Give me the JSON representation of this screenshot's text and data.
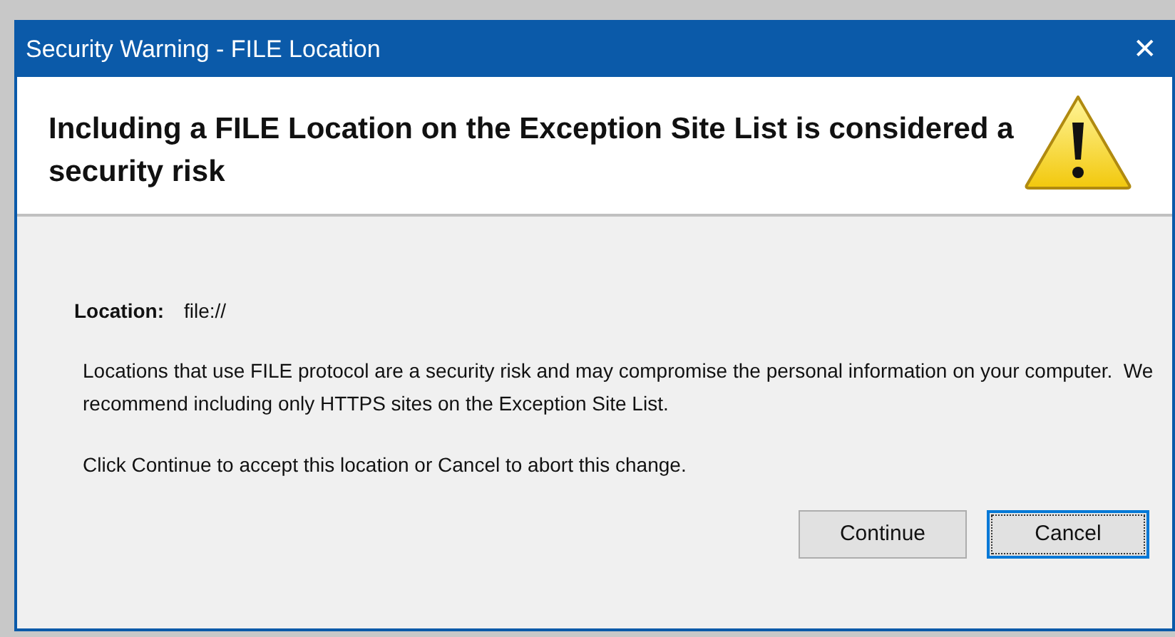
{
  "window": {
    "title": "Security Warning - FILE Location",
    "close": "✕"
  },
  "header": {
    "heading": "Including a FILE Location on the Exception Site List is considered a security risk"
  },
  "location": {
    "label": "Location:",
    "value": "file://"
  },
  "paragraphs": [
    "Locations that use FILE protocol are a security risk and may compromise the personal information on your computer.  We recommend including only HTTPS sites on the Exception Site List.",
    "Click Continue to accept this location or Cancel to abort this change."
  ],
  "buttons": [
    {
      "label": "Continue",
      "selected": false
    },
    {
      "label": "Cancel",
      "selected": true
    }
  ]
}
